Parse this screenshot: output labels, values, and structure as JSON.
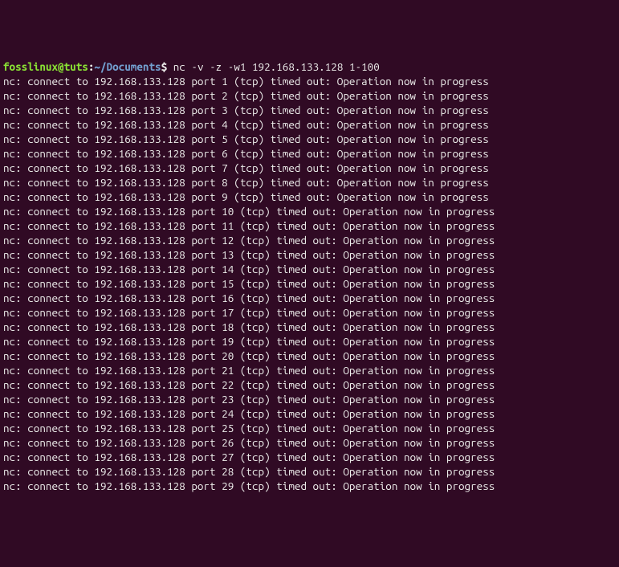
{
  "prompt": {
    "user": "fosslinux",
    "at": "@",
    "host": "tuts",
    "colon": ":",
    "path": "~/Documents",
    "dollar": "$ "
  },
  "command": "nc -v -z -w1 192.168.133.128 1-100",
  "ip": "192.168.133.128",
  "output_lines": [
    "nc: connect to 192.168.133.128 port 1 (tcp) timed out: Operation now in progress",
    "nc: connect to 192.168.133.128 port 2 (tcp) timed out: Operation now in progress",
    "nc: connect to 192.168.133.128 port 3 (tcp) timed out: Operation now in progress",
    "nc: connect to 192.168.133.128 port 4 (tcp) timed out: Operation now in progress",
    "nc: connect to 192.168.133.128 port 5 (tcp) timed out: Operation now in progress",
    "nc: connect to 192.168.133.128 port 6 (tcp) timed out: Operation now in progress",
    "nc: connect to 192.168.133.128 port 7 (tcp) timed out: Operation now in progress",
    "nc: connect to 192.168.133.128 port 8 (tcp) timed out: Operation now in progress",
    "nc: connect to 192.168.133.128 port 9 (tcp) timed out: Operation now in progress",
    "nc: connect to 192.168.133.128 port 10 (tcp) timed out: Operation now in progress",
    "nc: connect to 192.168.133.128 port 11 (tcp) timed out: Operation now in progress",
    "nc: connect to 192.168.133.128 port 12 (tcp) timed out: Operation now in progress",
    "nc: connect to 192.168.133.128 port 13 (tcp) timed out: Operation now in progress",
    "nc: connect to 192.168.133.128 port 14 (tcp) timed out: Operation now in progress",
    "nc: connect to 192.168.133.128 port 15 (tcp) timed out: Operation now in progress",
    "nc: connect to 192.168.133.128 port 16 (tcp) timed out: Operation now in progress",
    "nc: connect to 192.168.133.128 port 17 (tcp) timed out: Operation now in progress",
    "nc: connect to 192.168.133.128 port 18 (tcp) timed out: Operation now in progress",
    "nc: connect to 192.168.133.128 port 19 (tcp) timed out: Operation now in progress",
    "nc: connect to 192.168.133.128 port 20 (tcp) timed out: Operation now in progress",
    "nc: connect to 192.168.133.128 port 21 (tcp) timed out: Operation now in progress",
    "nc: connect to 192.168.133.128 port 22 (tcp) timed out: Operation now in progress",
    "nc: connect to 192.168.133.128 port 23 (tcp) timed out: Operation now in progress",
    "nc: connect to 192.168.133.128 port 24 (tcp) timed out: Operation now in progress",
    "nc: connect to 192.168.133.128 port 25 (tcp) timed out: Operation now in progress",
    "nc: connect to 192.168.133.128 port 26 (tcp) timed out: Operation now in progress",
    "nc: connect to 192.168.133.128 port 27 (tcp) timed out: Operation now in progress",
    "nc: connect to 192.168.133.128 port 28 (tcp) timed out: Operation now in progress",
    "nc: connect to 192.168.133.128 port 29 (tcp) timed out: Operation now in progress"
  ]
}
